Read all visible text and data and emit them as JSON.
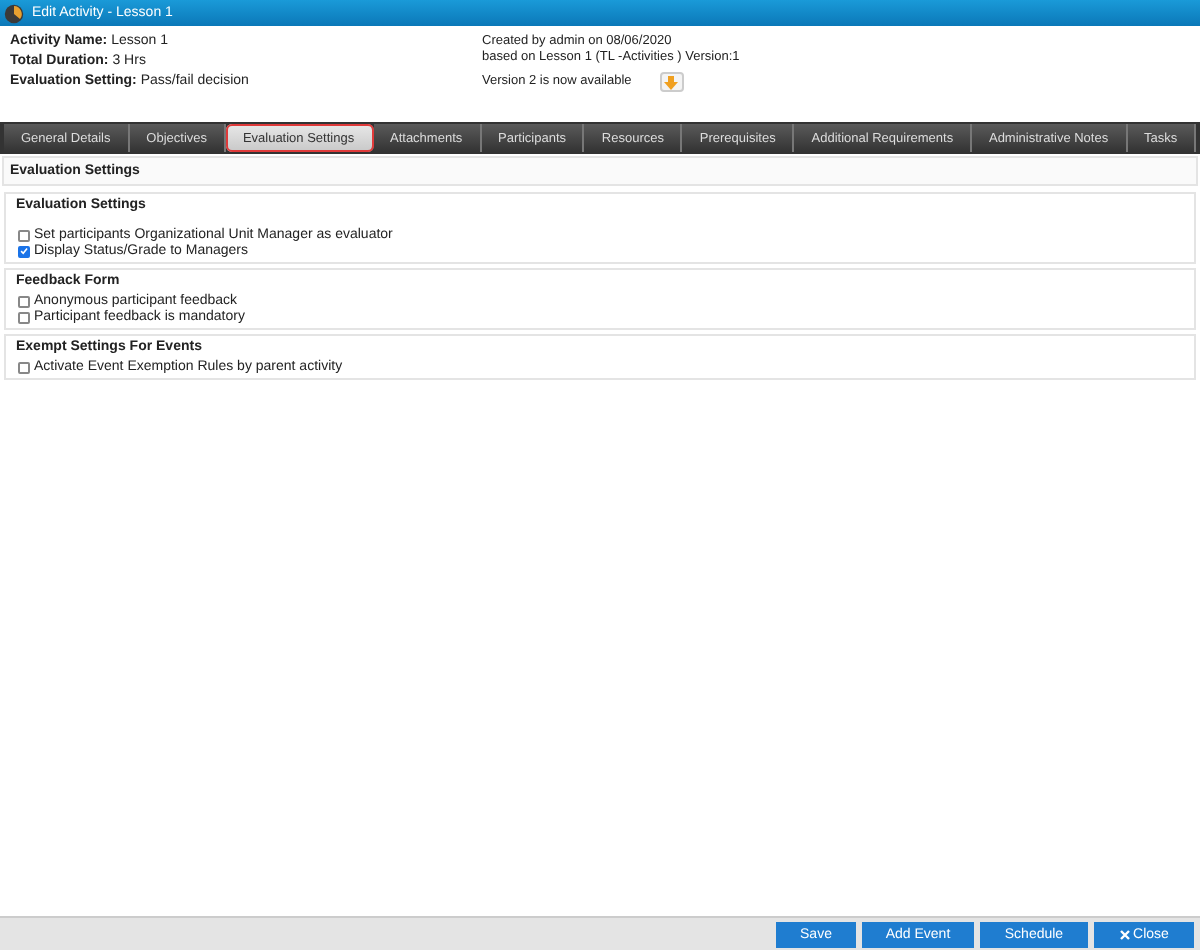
{
  "window": {
    "title": "Edit Activity - Lesson 1"
  },
  "summary": {
    "left": [
      {
        "label": "Activity Name:",
        "value": "Lesson 1"
      },
      {
        "label": "Total Duration:",
        "value": "3 Hrs"
      },
      {
        "label": "Evaluation Setting:",
        "value": "Pass/fail decision"
      }
    ],
    "created": "Created by admin on 08/06/2020",
    "based_on": "based on Lesson 1 (TL -Activities ) Version:1",
    "version_notice": "Version 2 is now available"
  },
  "tabs": [
    {
      "label": "General Details",
      "selected": false
    },
    {
      "label": "Objectives",
      "selected": false
    },
    {
      "label": "Evaluation Settings",
      "selected": true
    },
    {
      "label": "Attachments",
      "selected": false
    },
    {
      "label": "Participants",
      "selected": false
    },
    {
      "label": "Resources",
      "selected": false
    },
    {
      "label": "Prerequisites",
      "selected": false
    },
    {
      "label": "Additional Requirements",
      "selected": false
    },
    {
      "label": "Administrative Notes",
      "selected": false
    },
    {
      "label": "Tasks",
      "selected": false
    }
  ],
  "panel_title": "Evaluation Settings",
  "sections": [
    {
      "title": "Evaluation Settings",
      "items": [
        {
          "label": "Set participants Organizational Unit Manager as evaluator",
          "checked": false
        },
        {
          "label": "Display Status/Grade to Managers",
          "checked": true
        }
      ]
    },
    {
      "title": "Feedback Form",
      "items": [
        {
          "label": "Anonymous participant feedback",
          "checked": false
        },
        {
          "label": "Participant feedback is mandatory",
          "checked": false
        }
      ]
    },
    {
      "title": "Exempt Settings For Events",
      "items": [
        {
          "label": "Activate Event Exemption Rules by parent activity",
          "checked": false
        }
      ]
    }
  ],
  "buttons": [
    {
      "label": "Save",
      "kind": "plain"
    },
    {
      "label": "Add Event",
      "kind": "plain"
    },
    {
      "label": "Schedule",
      "kind": "plain"
    },
    {
      "label": "Close",
      "kind": "close"
    }
  ]
}
